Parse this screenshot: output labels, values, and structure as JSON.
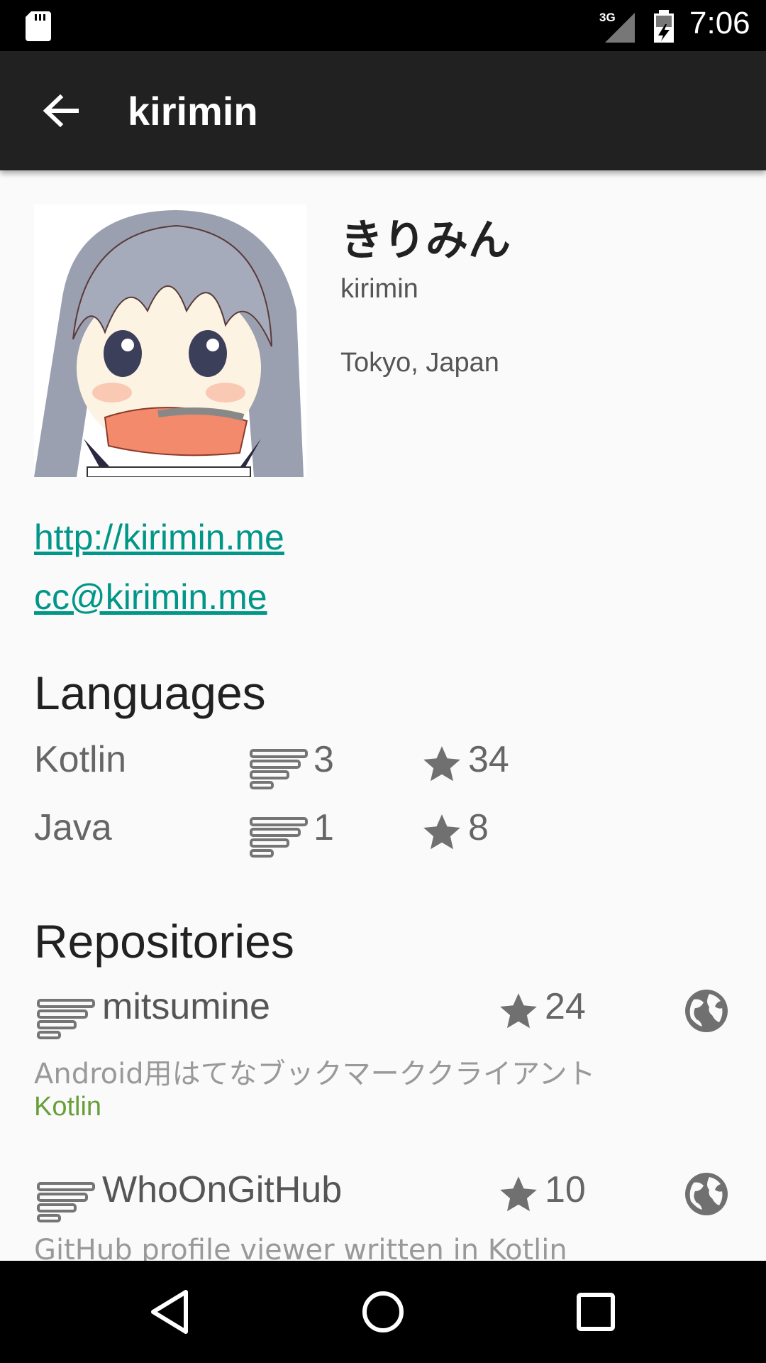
{
  "status_bar": {
    "time": "7:06",
    "network": "3G"
  },
  "app_bar": {
    "title": "kirimin"
  },
  "profile": {
    "display_name": "きりみん",
    "login": "kirimin",
    "location": "Tokyo, Japan",
    "blog": "http://kirimin.me",
    "email": "cc@kirimin.me"
  },
  "languages": {
    "title": "Languages",
    "items": [
      {
        "name": "Kotlin",
        "repos": "3",
        "stars": "34"
      },
      {
        "name": "Java",
        "repos": "1",
        "stars": "8"
      }
    ]
  },
  "repositories": {
    "title": "Repositories",
    "items": [
      {
        "name": "mitsumine",
        "stars": "24",
        "description": "Android用はてなブックマーククライアント",
        "language": "Kotlin"
      },
      {
        "name": "WhoOnGitHub",
        "stars": "10",
        "description": "GitHub profile viewer written in Kotlin",
        "language": ""
      }
    ]
  },
  "colors": {
    "link": "#009688",
    "language": "#689f38",
    "app_bar": "#212121"
  },
  "icons": [
    "sd-card-icon",
    "signal-icon",
    "battery-icon",
    "back-arrow-icon",
    "repo-icon",
    "star-icon",
    "globe-icon",
    "nav-back-icon",
    "nav-home-icon",
    "nav-recents-icon"
  ]
}
